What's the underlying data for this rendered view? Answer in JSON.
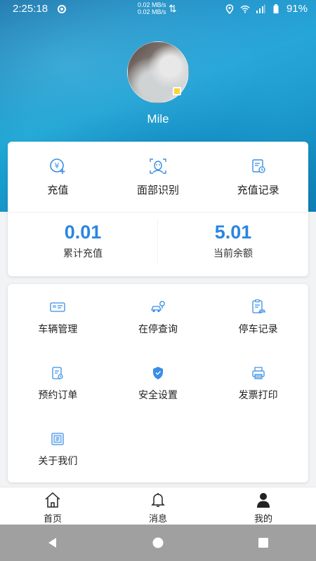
{
  "status_bar": {
    "time": "2:25:18",
    "net_speed_up": "0.02 MB/s",
    "net_speed_down": "0.02 MB/s",
    "battery": "91%"
  },
  "profile": {
    "name": "Mile"
  },
  "quick_actions": [
    {
      "label": "充值",
      "icon": "recharge-icon"
    },
    {
      "label": "面部识别",
      "icon": "face-recognition-icon"
    },
    {
      "label": "充值记录",
      "icon": "recharge-record-icon"
    }
  ],
  "stats": [
    {
      "value": "0.01",
      "label": "累计充值"
    },
    {
      "value": "5.01",
      "label": "当前余额"
    }
  ],
  "menu": [
    {
      "label": "车辆管理",
      "icon": "vehicle-card-icon"
    },
    {
      "label": "在停查询",
      "icon": "parking-query-icon"
    },
    {
      "label": "停车记录",
      "icon": "parking-record-icon"
    },
    {
      "label": "预约订单",
      "icon": "reservation-icon"
    },
    {
      "label": "安全设置",
      "icon": "shield-icon"
    },
    {
      "label": "发票打印",
      "icon": "printer-icon"
    },
    {
      "label": "关于我们",
      "icon": "about-icon"
    }
  ],
  "bottom_nav": [
    {
      "label": "首页",
      "icon": "home-icon"
    },
    {
      "label": "消息",
      "icon": "bell-icon"
    },
    {
      "label": "我的",
      "icon": "user-icon"
    }
  ],
  "colors": {
    "accent": "#2a86e0",
    "icon_blue": "#3a8ee6"
  }
}
